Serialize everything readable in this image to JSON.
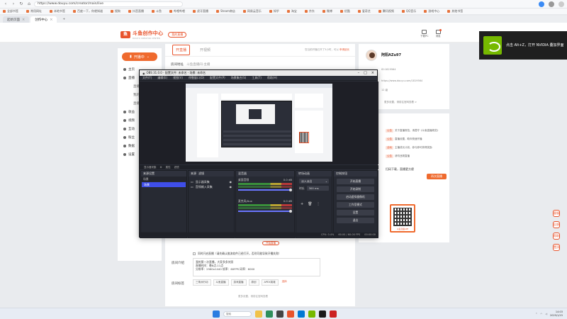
{
  "browser": {
    "url": "https://www.douyu.com/creator/main/live",
    "bookmarks": [
      "全部书签",
      "常用网址",
      "本地书签",
      "百度一下，你就知道",
      "搜狗",
      "抖音直播",
      "斗鱼",
      "哔哩哔哩",
      "虎牙直播",
      "Steam商店",
      "网易云音乐",
      "知乎",
      "淘宝",
      "京东",
      "微博",
      "优酷",
      "爱奇艺",
      "腾讯视频",
      "QQ音乐",
      "游戏中心",
      "其他书签"
    ],
    "tabs": [
      {
        "label": "起始页面"
      },
      {
        "label": "创作中心"
      }
    ],
    "new_tab": "+"
  },
  "site": {
    "logo_text": "斗鱼创作中心",
    "logo_sub": "DOUYU CREATOR CENTER",
    "badge": "我的直播",
    "header_icons": [
      {
        "label": "下载PC"
      },
      {
        "label": "消息"
      }
    ]
  },
  "left_nav": {
    "cta": "开播中",
    "items": [
      {
        "label": "主页",
        "type": "item"
      },
      {
        "label": "直播",
        "type": "item"
      },
      {
        "label": "直播设置",
        "type": "sub"
      },
      {
        "label": "我的直播",
        "type": "sub"
      },
      {
        "label": "直播回放",
        "type": "sub"
      },
      {
        "label": "收益",
        "type": "item"
      },
      {
        "label": "视频",
        "type": "item"
      },
      {
        "label": "互动",
        "type": "item"
      },
      {
        "label": "粉丝",
        "type": "item"
      },
      {
        "label": "数据",
        "type": "item"
      },
      {
        "label": "设置",
        "type": "item"
      }
    ]
  },
  "main": {
    "tabs": [
      {
        "label": "开直播",
        "active": true
      },
      {
        "label": "开视频",
        "active": false
      }
    ],
    "tip": "您当前开播已开了3小时，可以",
    "tip_link": "申请延长",
    "rows": [
      {
        "label": "房间地址",
        "value": "斗鱼直播间-主播"
      },
      {
        "label": "房间号",
        "value": ""
      },
      {
        "label": "直播类型",
        "value": ""
      }
    ],
    "under_button": "开始直播",
    "checkbox": "同时开启直播（请先确认推流软件已经打开，否则可能导致开播失败）",
    "intro_label": "房间介绍",
    "intro_lines": [
      "我的第一次直播，大家多多关照",
      "直播时间：晚8点-11点",
      "分辨率：2560x1440  帧率：60FPS  码率：6000"
    ],
    "tags_label": "房间标签",
    "tags": [
      "三角洲行动",
      "斗鱼直播",
      "游戏直播",
      "原创",
      "APEX英雄"
    ],
    "tags_more": "选择",
    "more_link": "更多设置，请前往官网查看"
  },
  "right": {
    "username": "阿阳AZu97",
    "uid_line": "ID:1819564",
    "link_line": "https://www.douyu.com/1819564",
    "level": "12 级",
    "more": "更多设置，请前往官网查看 >",
    "notices": [
      {
        "tag": "公告",
        "text": "关于直播规范，请遵守《斗鱼直播规范》"
      },
      {
        "tag": "公告",
        "text": "直播设置，助你快速开播"
      },
      {
        "tag": "活动",
        "text": "主播成长计划，参与即可获得奖励"
      },
      {
        "tag": "公告",
        "text": "请勿违规直播"
      }
    ],
    "app_title": "扫码下载，直播更方便",
    "app_btn": "再次直播",
    "qr_label": "斗鱼直播APP"
  },
  "float_tools": [
    "客服",
    "反馈",
    "帮助",
    "置顶"
  ],
  "nvidia_toast": {
    "text": "点击 Alt+Z，打开 NVIDIA 叠加界面"
  },
  "obs": {
    "title": "OBS 31.0.0 - 配置文件: 未命名 - 场景: 未命名",
    "menu": [
      "文件(F)",
      "编辑(E)",
      "视图(V)",
      "停靠窗口(D)",
      "配置文件(P)",
      "场景集合(S)",
      "工具(T)",
      "帮助(H)"
    ],
    "context_bar": [
      "显示器采集",
      "属性",
      "滤镜"
    ],
    "scenes": {
      "title": "来源设置",
      "header": "场景",
      "selected": "场景"
    },
    "sources": {
      "tab1": "来源",
      "tab2": "滤镜",
      "items": [
        {
          "label": "显示器采集"
        },
        {
          "label": "音频输入采集"
        }
      ]
    },
    "mixer": {
      "title": "混音器",
      "channels": [
        {
          "name": "桌面音频",
          "db": "0.0 dB"
        },
        {
          "name": "麦克风/Aux",
          "db": "0.0 dB"
        }
      ]
    },
    "transitions": {
      "title": "转场动画",
      "type": "淡入淡出",
      "duration_label": "时长",
      "duration": "300 ms"
    },
    "controls": {
      "title": "控制按钮",
      "buttons": [
        "开始直播",
        "开始录制",
        "启动虚拟摄像机",
        "工作室模式",
        "设置",
        "退出"
      ]
    },
    "status": [
      "CPU: 0.4%",
      "60.00 / 60.00 FPS",
      "00:00:00"
    ]
  },
  "taskbar": {
    "search": "搜索",
    "time": "14:03",
    "date": "2025/1/15"
  }
}
